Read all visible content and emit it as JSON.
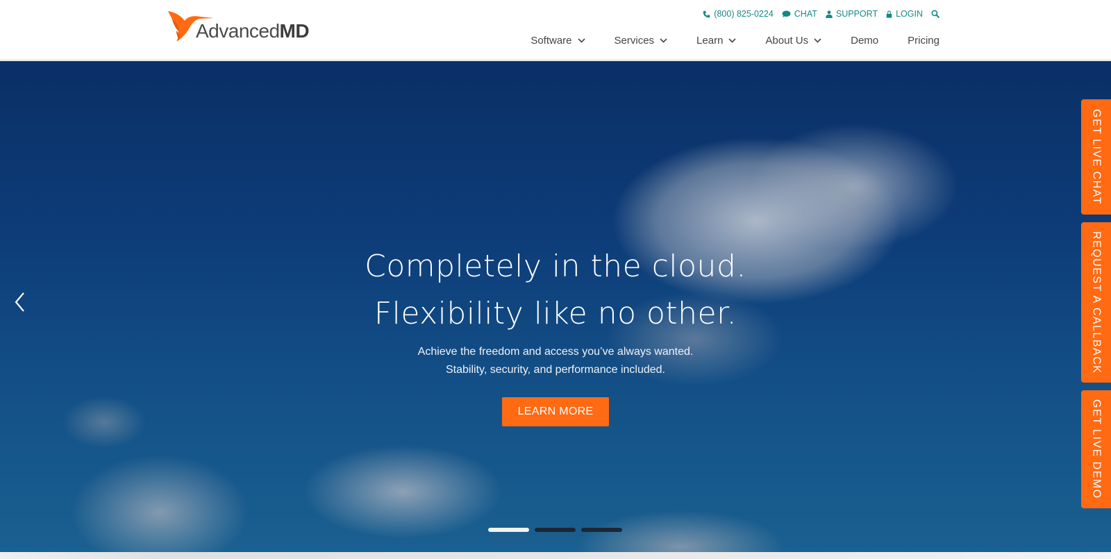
{
  "brand": {
    "name_light": "Advanced",
    "name_bold": "MD",
    "accent": "#ff6a13",
    "utility_color": "#138a83"
  },
  "utility": {
    "phone": "(800) 825-0224",
    "chat": "CHAT",
    "support": "SUPPORT",
    "login": "LOGIN"
  },
  "nav": {
    "items": [
      {
        "label": "Software",
        "dropdown": true
      },
      {
        "label": "Services",
        "dropdown": true
      },
      {
        "label": "Learn",
        "dropdown": true
      },
      {
        "label": "About Us",
        "dropdown": true
      },
      {
        "label": "Demo",
        "dropdown": false
      },
      {
        "label": "Pricing",
        "dropdown": false
      }
    ]
  },
  "hero": {
    "headline_1": "Completely in the cloud.",
    "headline_2": "Flexibility like no other.",
    "sub_1": "Achieve the freedom and access you’ve always wanted.",
    "sub_2": "Stability, security, and performance included.",
    "cta": "LEARN MORE",
    "slides_total": 3,
    "active_slide": 1
  },
  "side_tabs": [
    {
      "label": "GET LIVE CHAT"
    },
    {
      "label": "REQUEST A CALLBACK"
    },
    {
      "label": "GET LIVE DEMO"
    }
  ]
}
